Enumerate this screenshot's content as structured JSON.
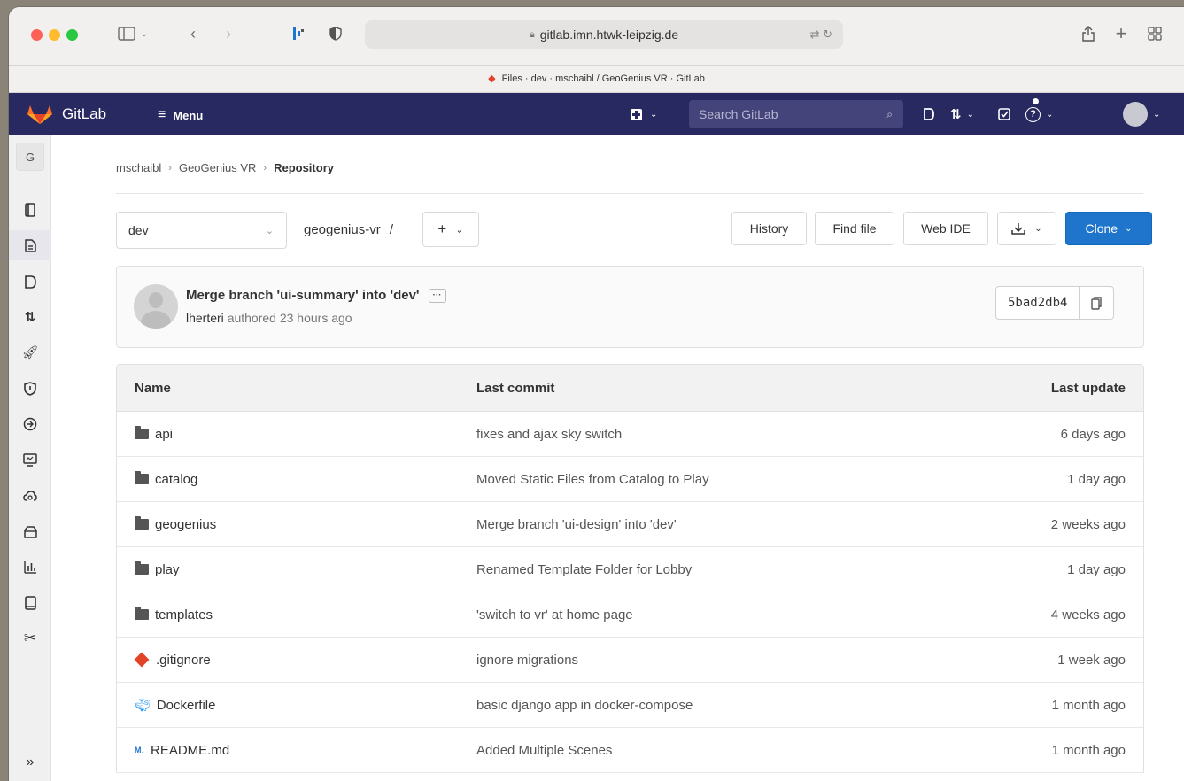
{
  "browser": {
    "url": "gitlab.imn.htwk-leipzig.de",
    "tab_title": "Files · dev · mschaibl / GeoGenius VR · GitLab"
  },
  "header": {
    "brand": "GitLab",
    "menu_label": "Menu",
    "search_placeholder": "Search GitLab"
  },
  "sidebar": {
    "project_initial": "G",
    "items": [
      "project-overview-icon",
      "repository-icon",
      "issues-icon",
      "merge-requests-icon",
      "ci-cd-icon",
      "security-icon",
      "deployments-icon",
      "monitor-icon",
      "infrastructure-icon",
      "packages-icon",
      "analytics-icon",
      "wiki-icon",
      "snippets-icon"
    ]
  },
  "breadcrumb": {
    "user": "mschaibl",
    "project": "GeoGenius VR",
    "current": "Repository"
  },
  "repo": {
    "branch": "dev",
    "path": "geogenius-vr",
    "path_sep": "/",
    "add_label": "+",
    "buttons": {
      "history": "History",
      "find_file": "Find file",
      "web_ide": "Web IDE",
      "clone": "Clone"
    }
  },
  "last_commit": {
    "title": "Merge branch 'ui-summary' into 'dev'",
    "author": "lherteri",
    "authored_text": "authored 23 hours ago",
    "sha": "5bad2db4"
  },
  "table": {
    "headers": {
      "name": "Name",
      "last_commit": "Last commit",
      "last_update": "Last update"
    },
    "rows": [
      {
        "icon": "folder",
        "name": "api",
        "commit": "fixes and ajax sky switch",
        "updated": "6 days ago"
      },
      {
        "icon": "folder",
        "name": "catalog",
        "commit": "Moved Static Files from Catalog to Play",
        "updated": "1 day ago"
      },
      {
        "icon": "folder",
        "name": "geogenius",
        "commit": "Merge branch 'ui-design' into 'dev'",
        "updated": "2 weeks ago"
      },
      {
        "icon": "folder",
        "name": "play",
        "commit": "Renamed Template Folder for Lobby",
        "updated": "1 day ago"
      },
      {
        "icon": "folder",
        "name": "templates",
        "commit": "'switch to vr' at home page",
        "updated": "4 weeks ago"
      },
      {
        "icon": "git",
        "name": ".gitignore",
        "commit": "ignore migrations",
        "updated": "1 week ago"
      },
      {
        "icon": "docker",
        "name": "Dockerfile",
        "commit": "basic django app in docker-compose",
        "updated": "1 month ago"
      },
      {
        "icon": "markdown",
        "name": "README.md",
        "commit": "Added Multiple Scenes",
        "updated": "1 month ago"
      }
    ]
  },
  "colors": {
    "header_bg": "#292961",
    "clone_btn": "#1f75cb",
    "gitlab_orange": "#e24329"
  }
}
